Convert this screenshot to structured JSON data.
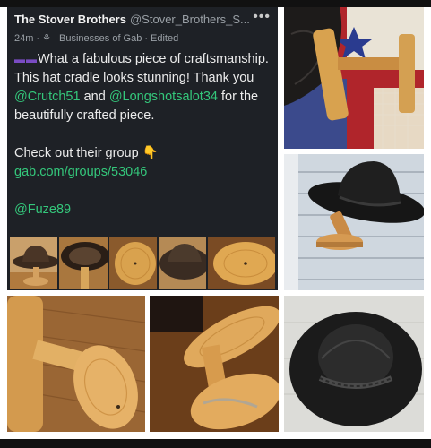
{
  "post": {
    "author": "The Stover Brothers",
    "handle": "@Stover_Brothers_S...",
    "more": "•••",
    "time": "24m",
    "group": "Businesses of Gab",
    "edited": "Edited",
    "emoji": "▬▬",
    "text_1": "What a fabulous piece of craftsmanship. This hat cradle looks stunning! Thank you ",
    "mention_1": "@Crutch51",
    "text_2": " and ",
    "mention_2": "@Longshotsalot34",
    "text_3": " for the beautifully crafted piece.",
    "text_4": "Check out their group ",
    "pointer": "👇",
    "group_link": "gab.com/groups/53046",
    "mention_3": "@Fuze89"
  },
  "colors": {
    "post_bg": "#1e2126",
    "link_green": "#34c77b",
    "wood": "#c98d4a",
    "quilt_red": "#b0252b",
    "leather": "#1b1b1b"
  }
}
